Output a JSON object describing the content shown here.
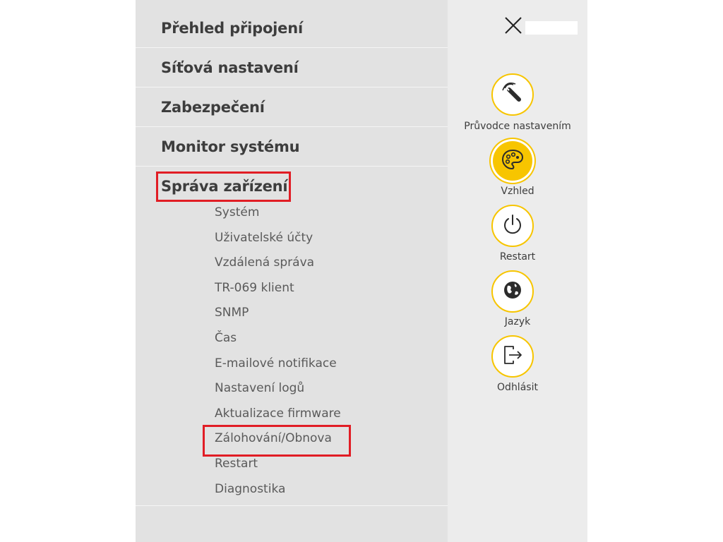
{
  "menu": {
    "sections": [
      {
        "label": "Přehled připojení"
      },
      {
        "label": "Síťová nastavení"
      },
      {
        "label": "Zabezpečení"
      },
      {
        "label": "Monitor systému"
      },
      {
        "label": "Správa zařízení"
      }
    ],
    "device_management_items": [
      {
        "label": "Systém"
      },
      {
        "label": "Uživatelské účty"
      },
      {
        "label": "Vzdálená správa"
      },
      {
        "label": "TR-069 klient"
      },
      {
        "label": "SNMP"
      },
      {
        "label": "Čas"
      },
      {
        "label": "E-mailové notifikace"
      },
      {
        "label": "Nastavení logů"
      },
      {
        "label": "Aktualizace firmware"
      },
      {
        "label": "Zálohování/Obnova"
      },
      {
        "label": "Restart"
      },
      {
        "label": "Diagnostika"
      }
    ]
  },
  "quick_actions": [
    {
      "label": "Průvodce nastavením",
      "icon": "wizard-wand-icon"
    },
    {
      "label": "Vzhled",
      "icon": "palette-icon"
    },
    {
      "label": "Restart",
      "icon": "power-icon"
    },
    {
      "label": "Jazyk",
      "icon": "globe-icon"
    },
    {
      "label": "Odhlásit",
      "icon": "logout-icon"
    }
  ],
  "colors": {
    "accent": "#f7c500",
    "highlight": "#e11d25",
    "menu_bg": "#e2e2e2",
    "side_bg": "#ececec"
  }
}
